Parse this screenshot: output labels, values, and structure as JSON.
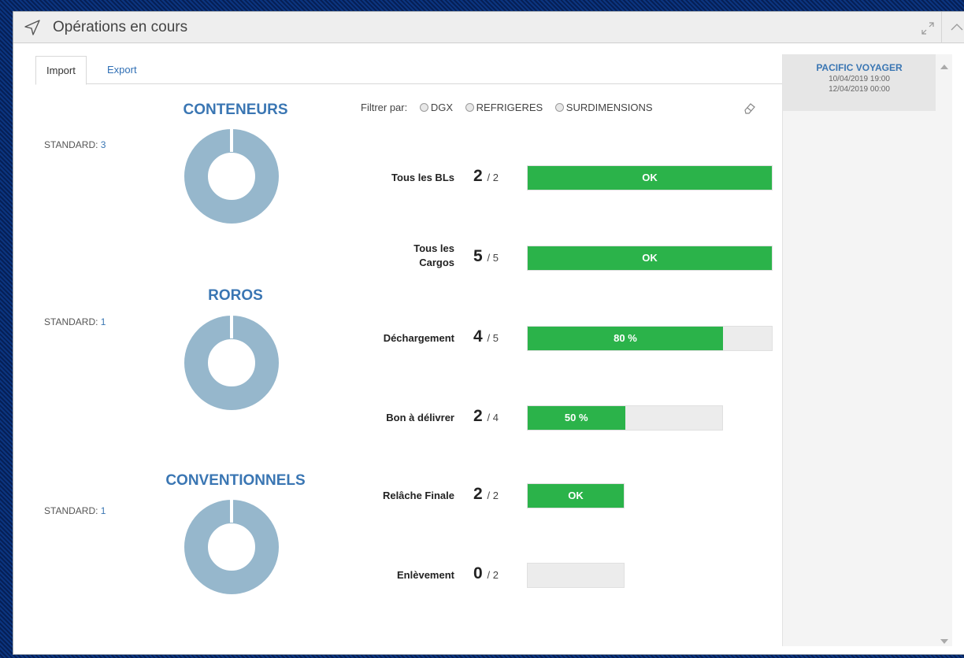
{
  "header": {
    "title": "Opérations en cours"
  },
  "tabs": [
    {
      "label": "Import"
    },
    {
      "label": "Export"
    }
  ],
  "sections": [
    {
      "title": "CONTENEURS",
      "standard_label": "STANDARD:",
      "standard_value": "3"
    },
    {
      "title": "ROROS",
      "standard_label": "STANDARD:",
      "standard_value": "1"
    },
    {
      "title": "CONVENTIONNELS",
      "standard_label": "STANDARD:",
      "standard_value": "1"
    }
  ],
  "filter": {
    "label": "Filtrer par:",
    "options": [
      "DGX",
      "REFRIGERES",
      "SURDIMENSIONS"
    ]
  },
  "progress_rows": [
    {
      "label": "Tous les BLs",
      "count": "2",
      "total": "/ 2",
      "bar_text": "OK",
      "fill_fraction": 1.0
    },
    {
      "label": "Tous les\nCargos",
      "count": "5",
      "total": "/ 5",
      "bar_text": "OK",
      "fill_fraction": 1.0
    },
    {
      "label": "Déchargement",
      "count": "4",
      "total": "/ 5",
      "bar_text": "80 %",
      "fill_fraction": 0.8
    },
    {
      "label": "Bon à délivrer",
      "count": "2",
      "total": "/ 4",
      "bar_text": "50 %",
      "fill_fraction": 0.5
    },
    {
      "label": "Relâche Finale",
      "count": "2",
      "total": "/ 2",
      "bar_text": "OK",
      "fill_fraction": 1.0
    },
    {
      "label": "Enlèvement",
      "count": "0",
      "total": "/ 2",
      "bar_text": "",
      "fill_fraction": 0.0
    }
  ],
  "voyage": {
    "name": "PACIFIC VOYAGER",
    "date_start": "10/04/2019 19:00",
    "date_end": "12/04/2019 00:00"
  },
  "colors": {
    "accent": "#3a76b3",
    "success": "#2bb34a",
    "donut": "#96b7cc"
  }
}
